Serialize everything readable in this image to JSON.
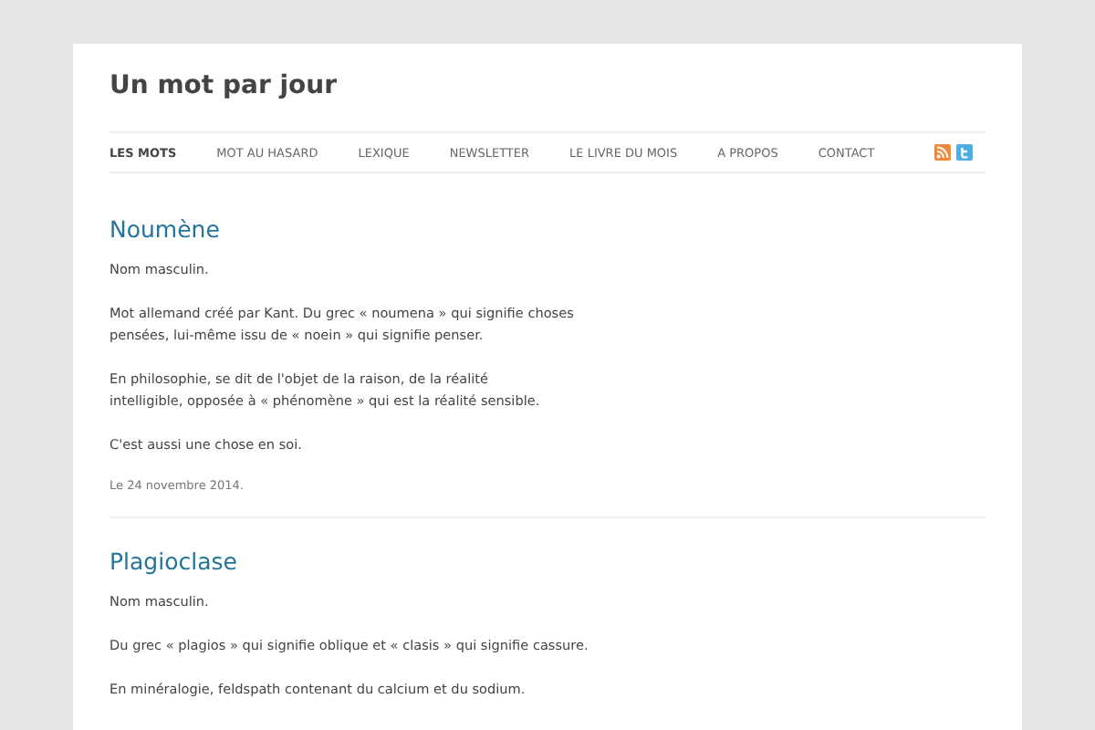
{
  "site": {
    "title": "Un mot par jour"
  },
  "nav": [
    {
      "label": "LES MOTS",
      "selected": true
    },
    {
      "label": "MOT AU HASARD",
      "selected": false
    },
    {
      "label": "LEXIQUE",
      "selected": false
    },
    {
      "label": "NEWSLETTER",
      "selected": false
    },
    {
      "label": "LE LIVRE DU MOIS",
      "selected": false
    },
    {
      "label": "A PROPOS",
      "selected": false
    },
    {
      "label": "CONTACT",
      "selected": false
    }
  ],
  "posts": [
    {
      "title": "Noumène",
      "paragraphs": [
        [
          "Nom masculin."
        ],
        [
          "Mot allemand créé par Kant. Du grec « noumena » qui signifie choses",
          "pensées, lui-même issu de « noein » qui signifie penser."
        ],
        [
          "En philosophie, se dit de l'objet de la raison, de la réalité",
          "intelligible, opposée à « phénomène » qui est la réalité sensible."
        ],
        [
          "C'est aussi une chose en soi."
        ]
      ],
      "date": "Le 24 novembre 2014."
    },
    {
      "title": "Plagioclase",
      "paragraphs": [
        [
          "Nom masculin."
        ],
        [
          "Du grec « plagios » qui signifie oblique et « clasis » qui signifie cassure."
        ],
        [
          "En minéralogie, feldspath contenant du calcium et du sodium."
        ]
      ]
    }
  ]
}
